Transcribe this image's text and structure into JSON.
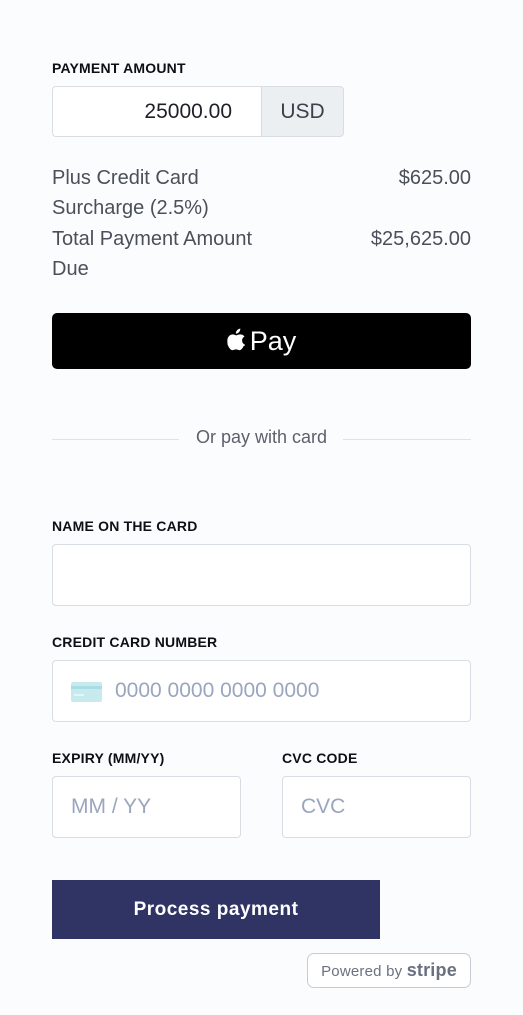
{
  "payment": {
    "section_label": "PAYMENT AMOUNT",
    "amount_value": "25000.00",
    "currency": "USD"
  },
  "summary": {
    "surcharge_label_line1": "Plus Credit Card",
    "surcharge_label_line2": "Surcharge (2.5%)",
    "surcharge_value": "$625.00",
    "total_label_line1": "Total Payment Amount",
    "total_label_line2": "Due",
    "total_value": "$25,625.00"
  },
  "apple_pay": {
    "label": "Pay"
  },
  "divider": {
    "text": "Or pay with card"
  },
  "card_form": {
    "name_label": "NAME ON THE CARD",
    "name_value": "",
    "number_label": "CREDIT CARD NUMBER",
    "number_placeholder": "0000 0000 0000 0000",
    "expiry_label": "EXPIRY (MM/YY)",
    "expiry_placeholder": "MM / YY",
    "cvc_label": "CVC CODE",
    "cvc_placeholder": "CVC"
  },
  "actions": {
    "process_label": "Process payment"
  },
  "footer": {
    "powered_by_text": "Powered by",
    "brand": "stripe"
  },
  "colors": {
    "accent": "#2f3464",
    "apple_pay_bg": "#000000",
    "card_icon": "#bfe7ec"
  },
  "icons": {
    "apple": "apple-logo-icon",
    "card": "credit-card-icon"
  }
}
